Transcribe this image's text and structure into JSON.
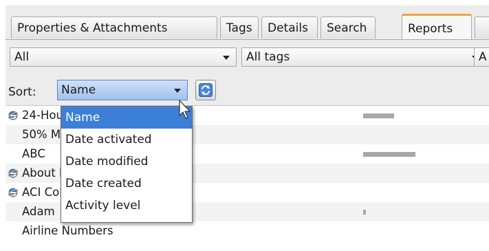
{
  "tabs": [
    {
      "label": "Properties & Attachments",
      "active": false
    },
    {
      "label": "Tags",
      "active": false
    },
    {
      "label": "Details",
      "active": false
    },
    {
      "label": "Search",
      "active": false
    },
    {
      "label": "Reports",
      "active": true
    }
  ],
  "filters": {
    "filter1": "All",
    "filter2": "All tags",
    "filter3": "A"
  },
  "sort": {
    "label": "Sort:",
    "value": "Name",
    "options": [
      "Name",
      "Date activated",
      "Date modified",
      "Date created",
      "Activity level"
    ]
  },
  "list": {
    "rows": [
      {
        "name": "24-Hour Circle",
        "ie_icon": true,
        "activity": 0.6
      },
      {
        "name": "50% Measure",
        "ie_icon": false,
        "activity": 0
      },
      {
        "name": "ABC",
        "ie_icon": false,
        "activity": 1.0
      },
      {
        "name": "About Portal",
        "ie_icon": true,
        "activity": 0
      },
      {
        "name": "ACI Collection",
        "ie_icon": true,
        "activity": 0
      },
      {
        "name": "Adam",
        "ie_icon": false,
        "activity": 0.05
      },
      {
        "name": "Airline Numbers",
        "ie_icon": false,
        "activity": 0
      }
    ]
  },
  "colors": {
    "active_tab_accent": "#f0a23a",
    "selection": "#3c7fd7"
  },
  "icons": {
    "refresh": "refresh-icon",
    "browser": "ie-icon",
    "pointer": "mouse-cursor"
  }
}
